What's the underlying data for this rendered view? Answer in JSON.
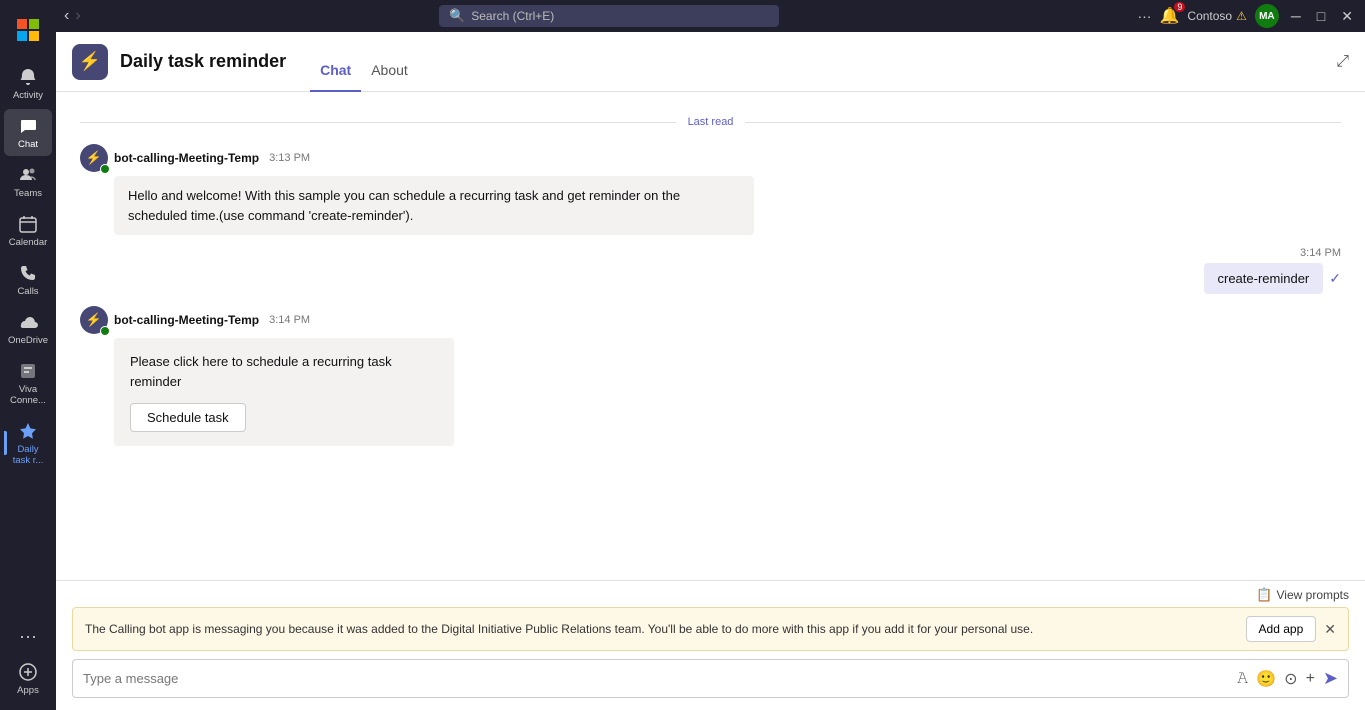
{
  "app": {
    "title": "MS",
    "window_controls": {
      "minimize": "─",
      "maximize": "□",
      "close": "✕"
    }
  },
  "sidebar": {
    "items": [
      {
        "id": "activity",
        "label": "Activity",
        "icon": "🔔"
      },
      {
        "id": "chat",
        "label": "Chat",
        "icon": "💬",
        "active": true
      },
      {
        "id": "teams",
        "label": "Teams",
        "icon": "👥"
      },
      {
        "id": "calendar",
        "label": "Calendar",
        "icon": "📅"
      },
      {
        "id": "calls",
        "label": "Calls",
        "icon": "📞"
      },
      {
        "id": "onedrive",
        "label": "OneDrive",
        "icon": "☁"
      },
      {
        "id": "viva",
        "label": "Viva Conne...",
        "icon": "🏢"
      },
      {
        "id": "daily-task",
        "label": "Daily task r...",
        "icon": "⚡",
        "active_blue": true
      }
    ],
    "bottom_items": [
      {
        "id": "more",
        "label": "...",
        "icon": "···"
      },
      {
        "id": "apps",
        "label": "Apps",
        "icon": "+"
      }
    ]
  },
  "titlebar": {
    "search_placeholder": "Search (Ctrl+E)",
    "nav_back": "‹",
    "nav_forward": "›",
    "more_icon": "···",
    "notification_badge": "9",
    "user_name": "Contoso",
    "user_warning": "⚠",
    "avatar_initials": "MA"
  },
  "chat_header": {
    "app_name": "Daily task reminder",
    "app_icon": "⚡",
    "tabs": [
      {
        "id": "chat",
        "label": "Chat",
        "active": true
      },
      {
        "id": "about",
        "label": "About",
        "active": false
      }
    ],
    "expand_icon": "⤢"
  },
  "messages": {
    "last_read_label": "Last read",
    "bot_name": "bot-calling-Meeting-Temp",
    "message1": {
      "time": "3:13 PM",
      "text": "Hello and welcome! With this sample you can schedule a recurring task and get reminder on the scheduled time.(use command 'create-reminder')."
    },
    "user_message": {
      "time": "3:14 PM",
      "text": "create-reminder"
    },
    "message2": {
      "time": "3:14 PM",
      "card_text": "Please click here to schedule a recurring task reminder",
      "button_label": "Schedule task"
    }
  },
  "bottom": {
    "view_prompts_label": "View prompts",
    "notification_text": "The Calling bot app is messaging you because it was added to the Digital Initiative Public Relations team. You'll be able to do more with this app if you add it for your personal use.",
    "add_app_label": "Add app",
    "message_placeholder": "Type a message"
  }
}
